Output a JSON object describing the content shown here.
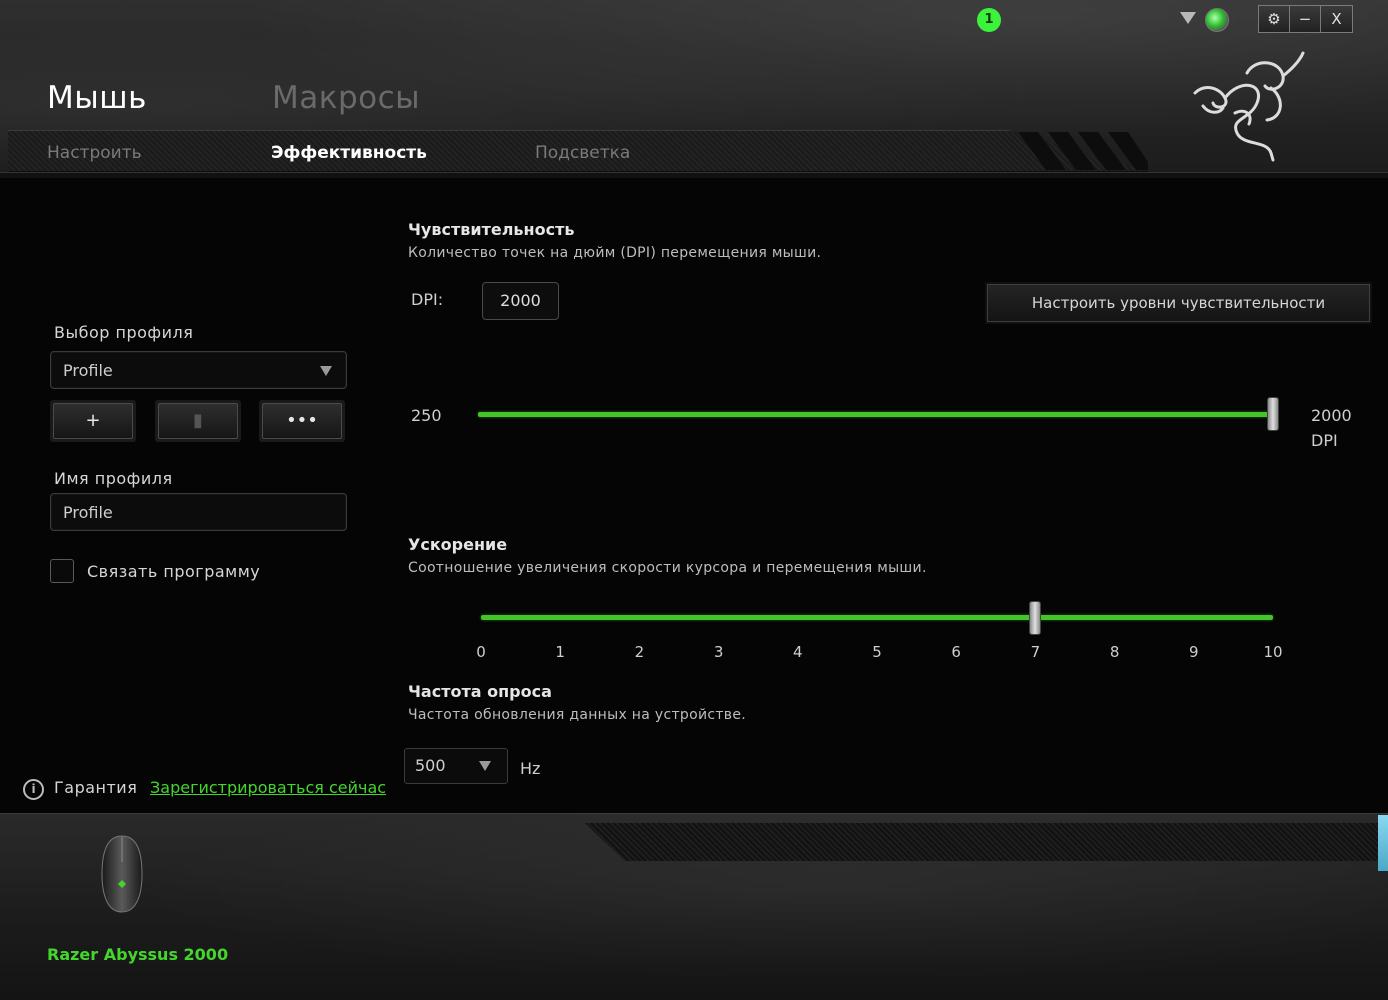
{
  "header": {
    "tabs": [
      {
        "label": "Мышь",
        "active": true
      },
      {
        "label": "Макросы",
        "active": false
      }
    ],
    "subtabs": [
      {
        "label": "Настроить",
        "active": false
      },
      {
        "label": "Эффективность",
        "active": true
      },
      {
        "label": "Подсветка",
        "active": false
      }
    ],
    "notification_count": "1",
    "window_buttons": {
      "settings": "⚙",
      "minimize": "−",
      "close": "X"
    }
  },
  "sidebar": {
    "profile_select_label": "Выбор профиля",
    "profile_selected": "Profile",
    "add_label": "+",
    "delete_label": "🗑",
    "more_label": "•••",
    "profile_name_label": "Имя профиля",
    "profile_name_value": "Profile",
    "link_program_label": "Связать программу",
    "warranty_label": "Гарантия",
    "register_link": "Зарегистрироваться сейчас"
  },
  "sensitivity": {
    "title": "Чувствительность",
    "description": "Количество точек на дюйм (DPI) перемещения мыши.",
    "dpi_label": "DPI:",
    "dpi_value": "2000",
    "configure_button": "Настроить уровни чувствительности",
    "min_label": "250",
    "max_label": "2000",
    "unit_label": "DPI",
    "slider_value": 2000,
    "slider_min": 250,
    "slider_max": 2000
  },
  "acceleration": {
    "title": "Ускорение",
    "description": "Соотношение увеличения скорости курсора и перемещения мыши.",
    "ticks": [
      "0",
      "1",
      "2",
      "3",
      "4",
      "5",
      "6",
      "7",
      "8",
      "9",
      "10"
    ],
    "value": 7
  },
  "polling": {
    "title": "Частота опроса",
    "description": "Частота обновления данных на устройстве.",
    "selected": "500",
    "unit": "Hz"
  },
  "footer": {
    "device_name": "Razer Abyssus 2000"
  },
  "colors": {
    "accent": "#44d62c"
  }
}
